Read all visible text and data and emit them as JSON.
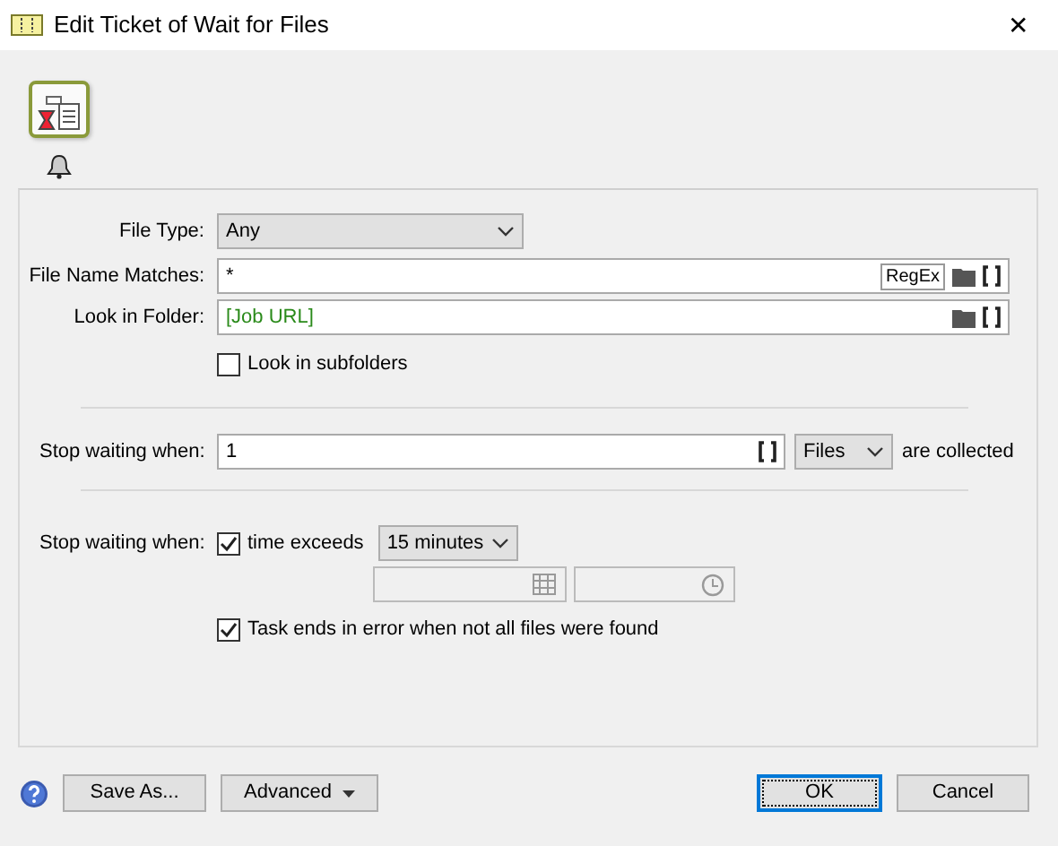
{
  "window": {
    "title": "Edit Ticket of Wait for Files",
    "close": "✕"
  },
  "file_type": {
    "label": "File Type:",
    "value": "Any"
  },
  "file_name": {
    "label": "File Name Matches:",
    "value": "*",
    "regex_button": "RegEx"
  },
  "folder": {
    "label": "Look in Folder:",
    "value": "[Job URL]"
  },
  "subfolders": {
    "label": "Look in subfolders",
    "checked": false
  },
  "count_rule": {
    "label": "Stop waiting when:",
    "value": "1",
    "unit": "Files",
    "suffix": "are collected"
  },
  "time_rule": {
    "label": "Stop waiting when:",
    "checkbox_label": "time exceeds",
    "checked": true,
    "duration": "15 minutes"
  },
  "error_rule": {
    "label": "Task ends in error when not all files were found",
    "checked": true
  },
  "buttons": [
    {
      "label": "Save As...",
      "kind": "plain",
      "default": false
    },
    {
      "label": "Advanced",
      "kind": "menu",
      "default": false
    },
    {
      "label": "OK",
      "kind": "plain",
      "default": true
    },
    {
      "label": "Cancel",
      "kind": "plain",
      "default": false
    }
  ]
}
